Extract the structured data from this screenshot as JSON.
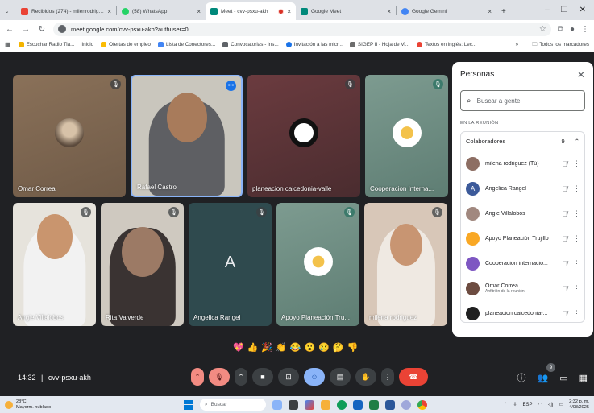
{
  "browser": {
    "tabs": [
      {
        "label": "Recibidos (274) - milenrodriguez",
        "favicon_color": "#ea4335",
        "active": false
      },
      {
        "label": "(58) WhatsApp",
        "favicon_color": "#25d366",
        "active": false
      },
      {
        "label": "Meet - cvv-psxu-akh",
        "favicon_color": "#00897b",
        "active": true,
        "recording": true
      },
      {
        "label": "Google Meet",
        "favicon_color": "#00897b",
        "active": false
      },
      {
        "label": "Google Gemini",
        "favicon_color": "#4285f4",
        "active": false
      }
    ],
    "new_tab": "+",
    "url": "meet.google.com/cvv-psxu-akh?authuser=0",
    "bookmarks": [
      {
        "label": "Escuchar Radio Tia...",
        "color": "#f4b400"
      },
      {
        "label": "Inicio",
        "color": "#ffffff"
      },
      {
        "label": "Ofertas de empleo",
        "color": "#fbbc04"
      },
      {
        "label": "Lista de Conectores...",
        "color": "#4285f4"
      },
      {
        "label": "Convocatorias - Ins...",
        "color": "#5f6368"
      },
      {
        "label": "Invitación a las micr...",
        "color": "#1a73e8"
      },
      {
        "label": "SIGEP II - Hoja de Vi...",
        "color": "#6d6d6d"
      },
      {
        "label": "Textos en inglés: Lec...",
        "color": "#ea4335"
      }
    ],
    "bookmarks_overflow": "»",
    "all_bookmarks": "Todos los marcadores"
  },
  "tiles": [
    {
      "name": "Omar Correa",
      "muted": true,
      "type": "avatar"
    },
    {
      "name": "Rafael Castro",
      "muted": false,
      "speaking": true,
      "type": "video"
    },
    {
      "name": "planeacion caicedonia-valle",
      "muted": true,
      "type": "logo"
    },
    {
      "name": "Cooperacion Interna...",
      "muted": true,
      "type": "logo"
    },
    {
      "name": "Angie Villalobos",
      "muted": true,
      "type": "video"
    },
    {
      "name": "Rita Valverde",
      "muted": true,
      "type": "video"
    },
    {
      "name": "Angelica Rangel",
      "muted": true,
      "type": "letter",
      "letter": "A"
    },
    {
      "name": "Apoyo Planeación Tru...",
      "muted": true,
      "type": "logo"
    },
    {
      "name": "milena rodriguez",
      "muted": true,
      "type": "video"
    }
  ],
  "meeting": {
    "time": "14:32",
    "code": "cvv-psxu-akh",
    "reactions": [
      "💖",
      "👍",
      "🎉",
      "👏",
      "😂",
      "😮",
      "😢",
      "🤔",
      "👎"
    ],
    "people_count": "9"
  },
  "panel": {
    "title": "Personas",
    "search_placeholder": "Buscar a gente",
    "section": "EN LA REUNIÓN",
    "group_title": "Colaboradores",
    "group_count": "9",
    "participants": [
      {
        "name": "milena rodriguez (Tú)",
        "sub": "",
        "color": "#8d6e63"
      },
      {
        "name": "Angelica Rangel",
        "sub": "",
        "color": "#3c5a9a",
        "letter": "A"
      },
      {
        "name": "Angie Villalobos",
        "sub": "",
        "color": "#a1887f"
      },
      {
        "name": "Apoyo Planeación Trujillo",
        "sub": "",
        "color": "#f9a825"
      },
      {
        "name": "Cooperacion internacio...",
        "sub": "",
        "color": "#7e57c2"
      },
      {
        "name": "Omar Correa",
        "sub": "Anfitrión de la reunión",
        "color": "#6d4c41"
      },
      {
        "name": "planeacion caicedonia-...",
        "sub": "",
        "color": "#212121"
      }
    ]
  },
  "taskbar": {
    "temp": "28°C",
    "weather": "Mayorm. nublado",
    "search": "Buscar",
    "lang": "ESP",
    "time": "2:32 p. m.",
    "date": "4/08/2025"
  }
}
